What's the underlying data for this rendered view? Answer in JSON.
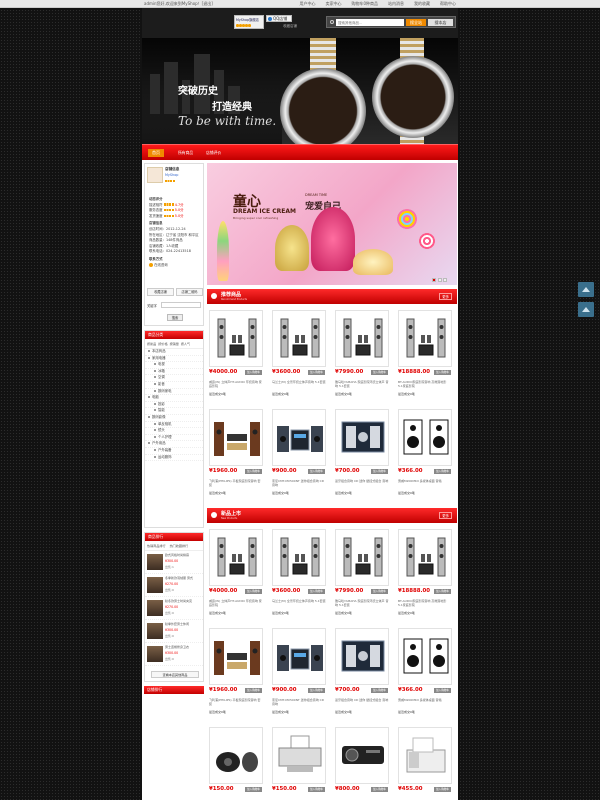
{
  "topbar": {
    "welcome": "admin您好,欢迎来到MyShop！[退出]",
    "links": [
      "用户中心",
      "卖家中心",
      "站内消息",
      "我的收藏",
      "帮助中心"
    ],
    "cart": "购物车0种商品"
  },
  "header": {
    "shop_name": "MyShop旗舰店",
    "qq_label": "QQ店铺",
    "fav_label": "收藏店铺",
    "search_placeholder": "搜索其他商品...",
    "search_btn": "搜全站",
    "search_store_btn": "搜本店"
  },
  "banner": {
    "title1": "突破历史",
    "title2": "打造经典",
    "slogan": "To be with time."
  },
  "nav": {
    "items": [
      "首页",
      "所有商品",
      "店铺评价"
    ]
  },
  "shop_card": {
    "title": "店铺信息",
    "owner": "MyShop",
    "rating_title": "动态评分",
    "rows": [
      "描述相符",
      "服务态度",
      "发货速度"
    ],
    "scores": [
      "4.7分",
      "5.0分",
      "5.0分"
    ],
    "info_title": "店铺信息",
    "info": [
      "创店时间：2012-12-24",
      "所在地区：辽宁省 沈阳市 和平区",
      "商品数量：148件商品",
      "店铺收藏：1人收藏",
      "联系电话：024-22413518"
    ],
    "contact_title": "联系方式",
    "wangwang": "在线咨询",
    "btn_collect": "收藏店铺",
    "btn_share": "店铺二维码",
    "search_label": "关键字",
    "search_btn": "搜索"
  },
  "category": {
    "title": "商品分类",
    "tabs": [
      "按新品",
      "按价格",
      "按销量",
      "按人气"
    ],
    "items": [
      "本店商品",
      "家用电器",
      "电视",
      "冰箱",
      "空调",
      "影音",
      "数码家电",
      "电脑",
      "投影",
      "智能",
      "数码影像",
      "单反相机",
      "镜头",
      "个人护理",
      "户外用品",
      "户外装备",
      "运动服饰"
    ]
  },
  "ranking": {
    "title": "商品排行",
    "tabs": [
      "热销商品排行",
      "热门收藏排行"
    ],
    "items": [
      {
        "name": "欧式风格时尚棉麻",
        "price": "¥300.00",
        "sold": "出售:1"
      },
      {
        "name": "冬季新款羽绒服 男式",
        "price": "¥270.00",
        "sold": "出售:0"
      },
      {
        "name": "秋冬款男士时尚夹克",
        "price": "¥270.00",
        "sold": "出售:0"
      },
      {
        "name": "秋季外套男士休闲",
        "price": "¥300.00",
        "sold": "出售:0"
      },
      {
        "name": "男士连帽修身卫衣",
        "price": "¥300.00",
        "sold": "出售:0"
      }
    ],
    "more": "查看本店其他商品"
  },
  "hotlist": {
    "title": "店铺排行"
  },
  "slider": {
    "title": "童心",
    "dream": "DREAM TIME",
    "cn": "宠爱自己",
    "en": "DREAM ICE CREAM",
    "sub": "Bringing super cool refreshing"
  },
  "sections": [
    {
      "title": "推荐商品",
      "subtitle": "Recommend Products",
      "more": "更多"
    },
    {
      "title": "新品上市",
      "subtitle": "New Products",
      "more": "更多"
    }
  ],
  "product_button": "加入购物车",
  "products": [
    {
      "price": "¥4000.00",
      "name": "威霸(W) 立体声HT-AUDIO 环绕音响 家庭影院",
      "sold": "最近成交0笔",
      "icon": "speaker-set-icon"
    },
    {
      "price": "¥3600.00",
      "name": "马兰士(M) 全景环绕立体声音响 5.1套装",
      "sold": "最近成交0笔",
      "icon": "speaker-set-icon"
    },
    {
      "price": "¥7990.00",
      "name": "雅马哈YAMAHA 家庭影院环绕立体声 音响 5.1套装",
      "sold": "最近成交0笔",
      "icon": "speaker-set-icon"
    },
    {
      "price": "¥18888.00",
      "name": "BT-AUDIO家庭影院音响 高端落地影 5.1家庭影院",
      "sold": "最近成交0笔",
      "icon": "speaker-set-icon"
    },
    {
      "price": "¥1960.00",
      "name": "飞利浦(PHILIPS) 平板家庭影院音响 套装",
      "sold": "最近成交0笔",
      "icon": "hifi-system-icon"
    },
    {
      "price": "¥900.00",
      "name": "索尼CMT-MX500NT 迷你组合音响 CD 音响",
      "sold": "最近成交0笔",
      "icon": "micro-system-icon"
    },
    {
      "price": "¥700.00",
      "name": "蓝牙组合音响 CD 迷你 壁挂式组合 音响",
      "sold": "最近成交0笔",
      "icon": "wall-system-icon"
    },
    {
      "price": "¥366.00",
      "name": "惠威M200MKII 多媒体桌面 音箱",
      "sold": "最近成交0笔",
      "icon": "bookshelf-speaker-icon"
    },
    {
      "price": "¥4000.00",
      "name": "威霸(W) 立体声HT-AUDIO 环绕音响 家庭影院",
      "sold": "最近成交0笔",
      "icon": "speaker-set-icon"
    },
    {
      "price": "¥3600.00",
      "name": "马兰士(M) 全景环绕立体声音响 5.1套装",
      "sold": "最近成交0笔",
      "icon": "speaker-set-icon"
    },
    {
      "price": "¥7990.00",
      "name": "雅马哈YAMAHA 家庭影院环绕立体声 音响 5.1套装",
      "sold": "最近成交0笔",
      "icon": "speaker-set-icon"
    },
    {
      "price": "¥18888.00",
      "name": "BT-AUDIO家庭影院音响 高端落地影 5.1家庭影院",
      "sold": "最近成交0笔",
      "icon": "speaker-set-icon"
    },
    {
      "price": "¥1960.00",
      "name": "飞利浦(PHILIPS) 平板家庭影院音响 套装",
      "sold": "最近成交0笔",
      "icon": "hifi-system-icon"
    },
    {
      "price": "¥900.00",
      "name": "索尼CMT-MX500NT 迷你组合音响 CD 音响",
      "sold": "最近成交0笔",
      "icon": "micro-system-icon"
    },
    {
      "price": "¥700.00",
      "name": "蓝牙组合音响 CD 迷你 壁挂式组合 音响",
      "sold": "最近成交0笔",
      "icon": "wall-system-icon"
    },
    {
      "price": "¥366.00",
      "name": "惠威M200MKII 多媒体桌面 音箱",
      "sold": "最近成交0笔",
      "icon": "bookshelf-speaker-icon"
    },
    {
      "price": "¥150.00",
      "name": "",
      "sold": "",
      "icon": "desktop-speaker-icon"
    },
    {
      "price": "¥150.00",
      "name": "",
      "sold": "",
      "icon": "printer-icon"
    },
    {
      "price": "¥800.00",
      "name": "",
      "sold": "",
      "icon": "projector-icon"
    },
    {
      "price": "¥455.00",
      "name": "",
      "sold": "",
      "icon": "fax-machine-icon"
    }
  ],
  "colors": {
    "accent": "#e00000",
    "orange": "#f08a00",
    "background": "#121212"
  }
}
